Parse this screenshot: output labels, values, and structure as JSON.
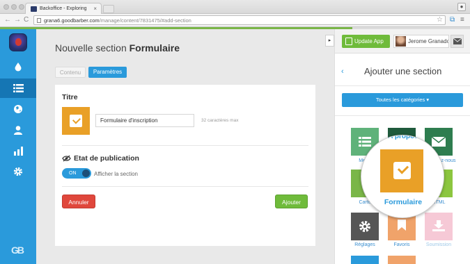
{
  "browser": {
    "tab_title": "Backoffice - Exploring",
    "tab_close": "×",
    "url_host": "grana6.goodbarber.com",
    "url_path": "/manage/content/7831475/#add-section",
    "back": "←",
    "forward": "→",
    "reload": "C",
    "progress_fraction": 0.75
  },
  "sidebar": {
    "items": [
      {
        "icon": "drop-icon"
      },
      {
        "icon": "list-icon",
        "active": true
      },
      {
        "icon": "globe-icon"
      },
      {
        "icon": "user-icon"
      },
      {
        "icon": "stats-icon"
      },
      {
        "icon": "gear-icon"
      }
    ],
    "brand": "GB"
  },
  "main": {
    "title_prefix": "Nouvelle section",
    "title_bold": "Formulaire",
    "tabs": [
      {
        "label": "Contenu",
        "active": false
      },
      {
        "label": "Paramètres",
        "active": true
      }
    ],
    "title_section": "Titre",
    "title_value": "Formulaire d'inscription",
    "title_hint": "32 caractères max",
    "publication_section": "Etat de publication",
    "toggle_state": "ON",
    "toggle_label": "Afficher la section",
    "cancel_label": "Annuler",
    "add_label": "Ajouter"
  },
  "right_panel": {
    "update_label": "Update App",
    "user_name": "Jerome Granados",
    "title": "Ajouter une section",
    "back": "‹",
    "category_dropdown": "Toutes les catégories ▾",
    "collapse_arrow": "▸",
    "tiles": [
      {
        "label": "Menu",
        "color": "#5fb27a",
        "icon": "list-icon"
      },
      {
        "label": "À propos",
        "color": "#1f5a3c",
        "icon": "info-icon"
      },
      {
        "label": "Contactez-nous",
        "color": "#2e7d4f",
        "icon": "mail-icon"
      },
      {
        "label": "Carte",
        "color": "#7ab648",
        "icon": "map-icon"
      },
      {
        "label": "HTML",
        "color": "#8cc63f",
        "icon": "code-icon"
      },
      {
        "label": "Réglages",
        "color": "#555555",
        "icon": "gear-icon"
      },
      {
        "label": "Favoris",
        "color": "#f0a36a",
        "icon": "bookmark-icon"
      },
      {
        "label": "Soumission",
        "color": "#f6c9d6",
        "icon": "download-icon"
      }
    ],
    "zoom_label": "Formulaire",
    "zoom_top_label": "A propos"
  }
}
